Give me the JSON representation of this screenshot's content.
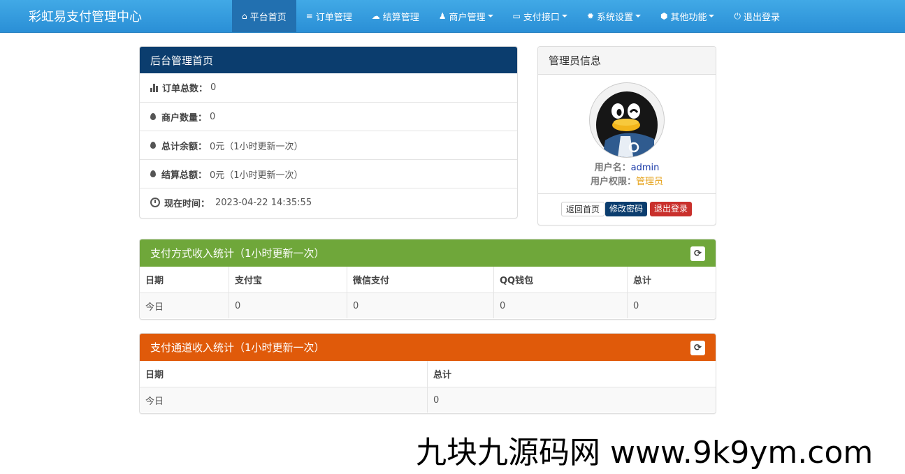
{
  "brand": "彩虹易支付管理中心",
  "nav": [
    {
      "label": "平台首页",
      "icon": "home-icon",
      "glyph": "⌂",
      "active": true,
      "dropdown": false
    },
    {
      "label": "订单管理",
      "icon": "list-icon",
      "glyph": "≡",
      "active": false,
      "dropdown": false
    },
    {
      "label": "结算管理",
      "icon": "cloud-icon",
      "glyph": "☁",
      "active": false,
      "dropdown": false
    },
    {
      "label": "商户管理",
      "icon": "user-icon",
      "glyph": "♟",
      "active": false,
      "dropdown": true
    },
    {
      "label": "支付接口",
      "icon": "credit-card-icon",
      "glyph": "▭",
      "active": false,
      "dropdown": true
    },
    {
      "label": "系统设置",
      "icon": "gear-icon",
      "glyph": "✹",
      "active": false,
      "dropdown": true
    },
    {
      "label": "其他功能",
      "icon": "cube-icon",
      "glyph": "⬢",
      "active": false,
      "dropdown": true
    },
    {
      "label": "退出登录",
      "icon": "power-icon",
      "glyph": "⏻",
      "active": false,
      "dropdown": false
    }
  ],
  "overview": {
    "title": "后台管理首页",
    "rows": [
      {
        "label": "订单总数：",
        "value": "0"
      },
      {
        "label": "商户数量：",
        "value": "0"
      },
      {
        "label": "总计余额：",
        "value": "0元（1小时更新一次）"
      },
      {
        "label": "结算总额：",
        "value": "0元（1小时更新一次）"
      },
      {
        "label": "现在时间：",
        "value": "2023-04-22 14:35:55"
      }
    ]
  },
  "admin": {
    "title": "管理员信息",
    "username_label": "用户名：",
    "username": "admin",
    "role_label": "用户权限：",
    "role": "管理员",
    "buttons": {
      "home": "返回首页",
      "change_password": "修改密码",
      "logout": "退出登录"
    }
  },
  "pay_stats": {
    "title": "支付方式收入统计（1小时更新一次）",
    "headers": [
      "日期",
      "支付宝",
      "微信支付",
      "QQ钱包",
      "总计"
    ],
    "rows": [
      [
        "今日",
        "0",
        "0",
        "0",
        "0"
      ]
    ]
  },
  "channel_stats": {
    "title": "支付通道收入统计（1小时更新一次）",
    "headers": [
      "日期",
      "总计"
    ],
    "rows": [
      [
        "今日",
        "0"
      ]
    ]
  },
  "watermark": "九块九源码网 www.9k9ym.com",
  "colors": {
    "navbar": "#2a8fd6",
    "overview_head": "#0b3d6e",
    "pay_head": "#6fa73a",
    "channel_head": "#e05a0a",
    "btn_primary": "#0b3d6e",
    "btn_danger": "#c9302c",
    "role_color": "#e6a21a"
  }
}
